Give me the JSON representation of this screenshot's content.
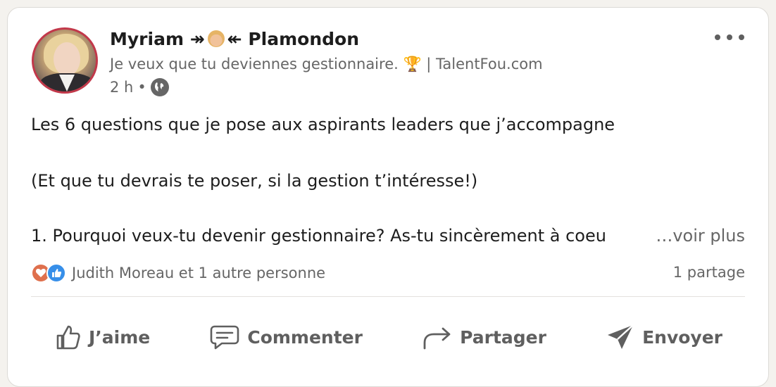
{
  "author": {
    "name_first": "Myriam",
    "arrow_left": "↠",
    "arrow_right": "↞",
    "name_last": "Plamondon",
    "headline": "Je veux que tu deviennes gestionnaire. 🏆 | TalentFou.com",
    "time": "2 h",
    "dot": "•"
  },
  "post": {
    "line1": "Les 6 questions que je pose aux aspirants leaders que j’accompagne",
    "line2": "(Et que tu devrais te poser, si la gestion t’intéresse!)",
    "line3": "1. Pourquoi veux-tu devenir gestionnaire? As-tu sincèrement à coeu",
    "see_more": "…voir plus"
  },
  "social": {
    "reactions_text": "Judith Moreau et 1 autre personne",
    "shares_text": "1 partage"
  },
  "actions": {
    "like": "J’aime",
    "comment": "Commenter",
    "share": "Partager",
    "send": "Envoyer"
  },
  "colors": {
    "avatar_ring": "#c2384a",
    "reaction_heart": "#df704d",
    "reaction_like": "#378fe9",
    "secondary_text": "#666666"
  },
  "icons": [
    "globe-icon",
    "more-options-icon",
    "heart-reaction-icon",
    "like-reaction-icon",
    "thumbs-up-icon",
    "comment-icon",
    "share-arrow-icon",
    "send-icon"
  ]
}
